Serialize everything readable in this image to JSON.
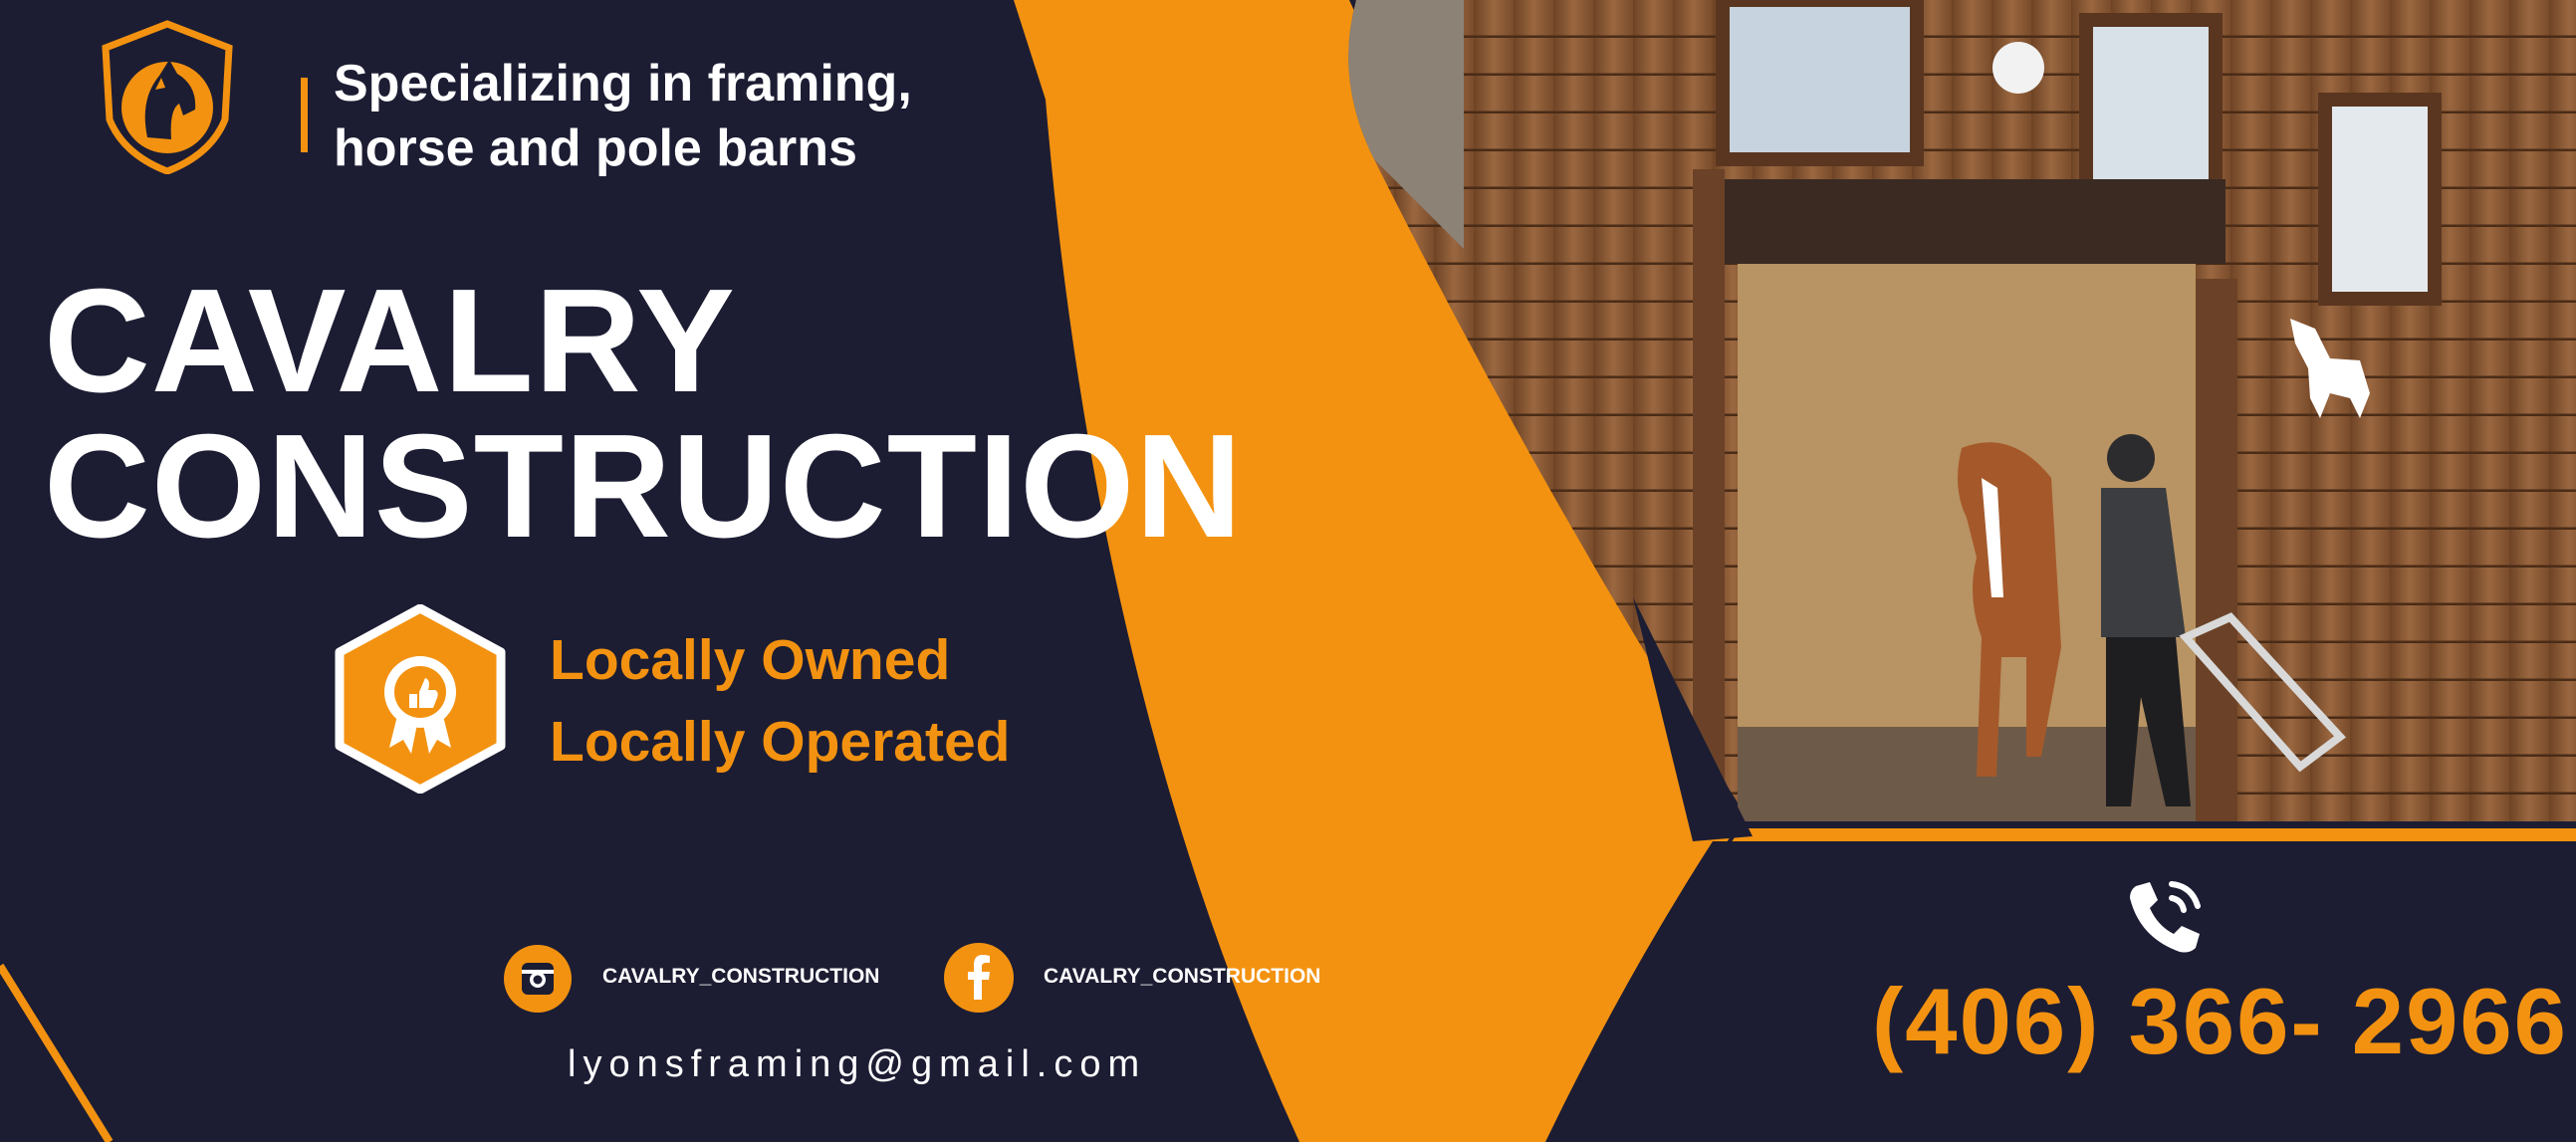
{
  "tagline": [
    "Specializing in framing,",
    "horse and pole barns"
  ],
  "brand": {
    "title_line1": "CAVALRY",
    "title_line2": "CONSTRUCTION"
  },
  "features": [
    "Locally Owned",
    "Locally Operated"
  ],
  "social": [
    {
      "icon": "instagram-icon",
      "handle": "CAVALRY_CONSTRUCTION"
    },
    {
      "icon": "facebook-icon",
      "handle": "CAVALRY_CONSTRUCTION"
    }
  ],
  "contact": {
    "email": "lyonsframing@gmail.com",
    "phone": "(406) 366- 2966",
    "phone_icon": "phone-icon"
  },
  "photo": {
    "subject": "barn-doorway-photo"
  },
  "colors": {
    "navy": "#1c1d33",
    "orange": "#f39210",
    "white": "#ffffff",
    "wood": "#8a5a35"
  }
}
